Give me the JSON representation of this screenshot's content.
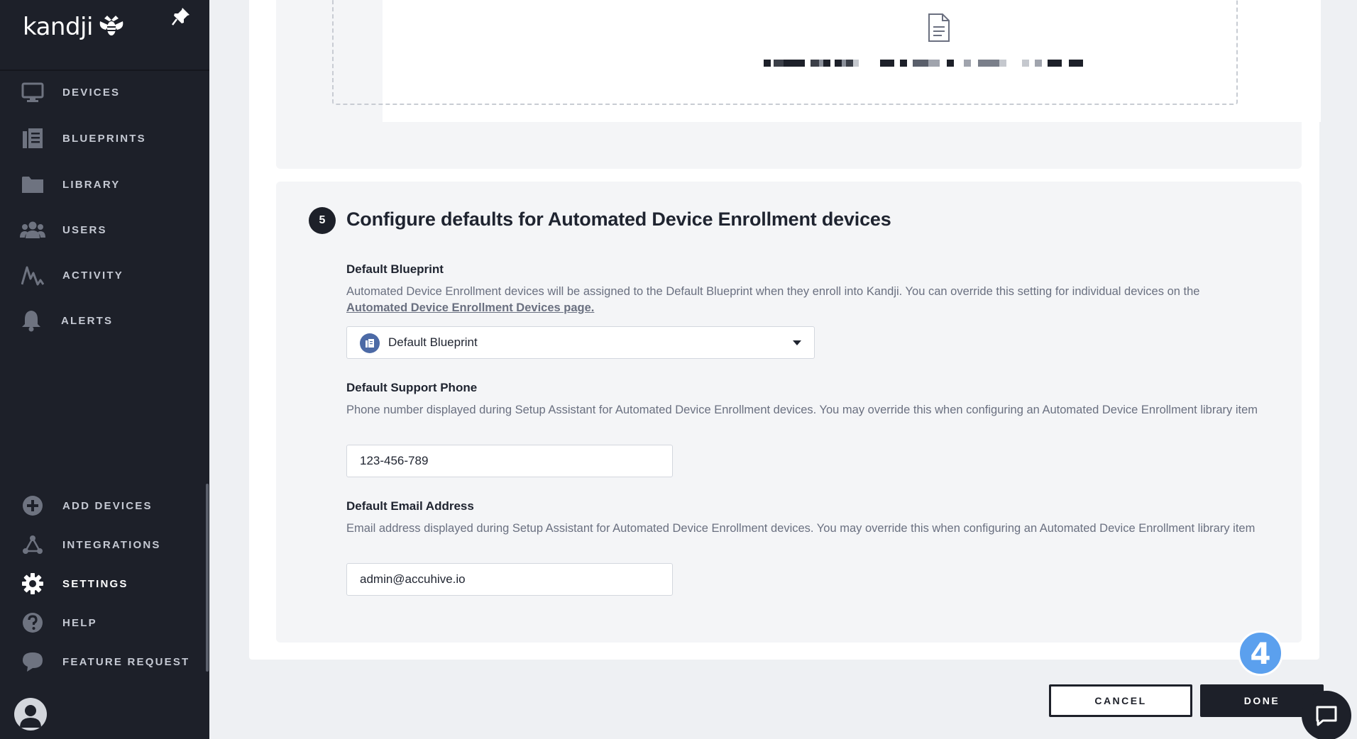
{
  "brand": {
    "name": "kandji"
  },
  "sidebar": {
    "items": [
      {
        "label": "DEVICES",
        "icon": "monitor-icon"
      },
      {
        "label": "BLUEPRINTS",
        "icon": "blueprints-icon"
      },
      {
        "label": "LIBRARY",
        "icon": "folder-icon"
      },
      {
        "label": "USERS",
        "icon": "users-icon"
      },
      {
        "label": "ACTIVITY",
        "icon": "activity-icon"
      },
      {
        "label": "ALERTS",
        "icon": "bell-icon"
      }
    ],
    "bottom_items": [
      {
        "label": "ADD DEVICES",
        "icon": "plus-circle-icon"
      },
      {
        "label": "INTEGRATIONS",
        "icon": "integrations-icon"
      },
      {
        "label": "SETTINGS",
        "icon": "gear-icon",
        "active": true
      },
      {
        "label": "HELP",
        "icon": "help-icon"
      },
      {
        "label": "FEATURE REQUEST",
        "icon": "chat-icon"
      }
    ]
  },
  "section": {
    "step": "5",
    "title": "Configure defaults for Automated Device Enrollment devices",
    "blueprint": {
      "label": "Default Blueprint",
      "description": "Automated Device Enrollment devices will be assigned to the Default Blueprint when they enroll into Kandji. You can override this setting for individual devices on the",
      "link": "Automated Device Enrollment Devices page.",
      "selected": "Default Blueprint"
    },
    "phone": {
      "label": "Default Support Phone",
      "description": "Phone number displayed during Setup Assistant for Automated Device Enrollment devices. You may override this when configuring an Automated Device Enrollment library item",
      "value": "123-456-789"
    },
    "email": {
      "label": "Default Email Address",
      "description": "Email address displayed during Setup Assistant for Automated Device Enrollment devices. You may override this when configuring an Automated Device Enrollment library item",
      "value": "admin@accuhive.io"
    }
  },
  "walkthrough": {
    "step": "4"
  },
  "footer": {
    "cancel_label": "CANCEL",
    "done_label": "DONE"
  },
  "colors": {
    "sidebar_bg": "#1d2029",
    "accent_blue": "#5ba0ee",
    "page_bg": "#eef0f3"
  }
}
